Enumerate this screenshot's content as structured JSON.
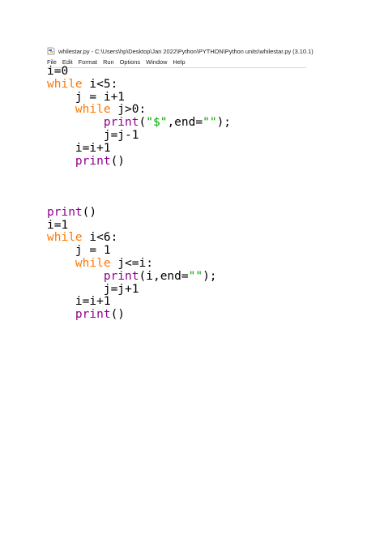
{
  "window": {
    "title": "whilestar.py - C:\\Users\\hp\\Desktop\\Jan 2022\\Python\\PYTHON\\Python units\\whilestar.py (3.10.1)",
    "icon": "python-idle-icon"
  },
  "menu": [
    "File",
    "Edit",
    "Format",
    "Run",
    "Options",
    "Window",
    "Help"
  ],
  "colors": {
    "keyword": "#ff7700",
    "builtin": "#900090",
    "string": "#00aa00",
    "text": "#000000"
  },
  "code": {
    "block1": [
      [
        {
          "t": "i=0",
          "c": "tx"
        }
      ],
      [
        {
          "t": "while",
          "c": "kw"
        },
        {
          "t": " i<5:",
          "c": "tx"
        }
      ],
      [
        {
          "t": "    j = i+1",
          "c": "tx"
        }
      ],
      [
        {
          "t": "    ",
          "c": "tx"
        },
        {
          "t": "while",
          "c": "kw"
        },
        {
          "t": " j>0:",
          "c": "tx"
        }
      ],
      [
        {
          "t": "        ",
          "c": "tx"
        },
        {
          "t": "print",
          "c": "bi"
        },
        {
          "t": "(",
          "c": "tx"
        },
        {
          "t": "\"$\"",
          "c": "st"
        },
        {
          "t": ",end=",
          "c": "tx"
        },
        {
          "t": "\"\"",
          "c": "st"
        },
        {
          "t": ");",
          "c": "tx"
        }
      ],
      [
        {
          "t": "        j=j-1",
          "c": "tx"
        }
      ],
      [
        {
          "t": "    i=i+1",
          "c": "tx"
        }
      ],
      [
        {
          "t": "    ",
          "c": "tx"
        },
        {
          "t": "print",
          "c": "bi"
        },
        {
          "t": "()",
          "c": "tx"
        }
      ]
    ],
    "block2": [
      [
        {
          "t": "print",
          "c": "bi"
        },
        {
          "t": "()",
          "c": "tx"
        }
      ],
      [
        {
          "t": "i=1",
          "c": "tx"
        }
      ],
      [
        {
          "t": "while",
          "c": "kw"
        },
        {
          "t": " i<6:",
          "c": "tx"
        }
      ],
      [
        {
          "t": "    j = 1",
          "c": "tx"
        }
      ],
      [
        {
          "t": "    ",
          "c": "tx"
        },
        {
          "t": "while",
          "c": "kw"
        },
        {
          "t": " j<=i:",
          "c": "tx"
        }
      ],
      [
        {
          "t": "        ",
          "c": "tx"
        },
        {
          "t": "print",
          "c": "bi"
        },
        {
          "t": "(i,end=",
          "c": "tx"
        },
        {
          "t": "\"\"",
          "c": "st"
        },
        {
          "t": ");",
          "c": "tx"
        }
      ],
      [
        {
          "t": "        j=j+1",
          "c": "tx"
        }
      ],
      [
        {
          "t": "    i=i+1",
          "c": "tx"
        }
      ],
      [
        {
          "t": "    ",
          "c": "tx"
        },
        {
          "t": "print",
          "c": "bi"
        },
        {
          "t": "()",
          "c": "tx"
        }
      ]
    ]
  }
}
